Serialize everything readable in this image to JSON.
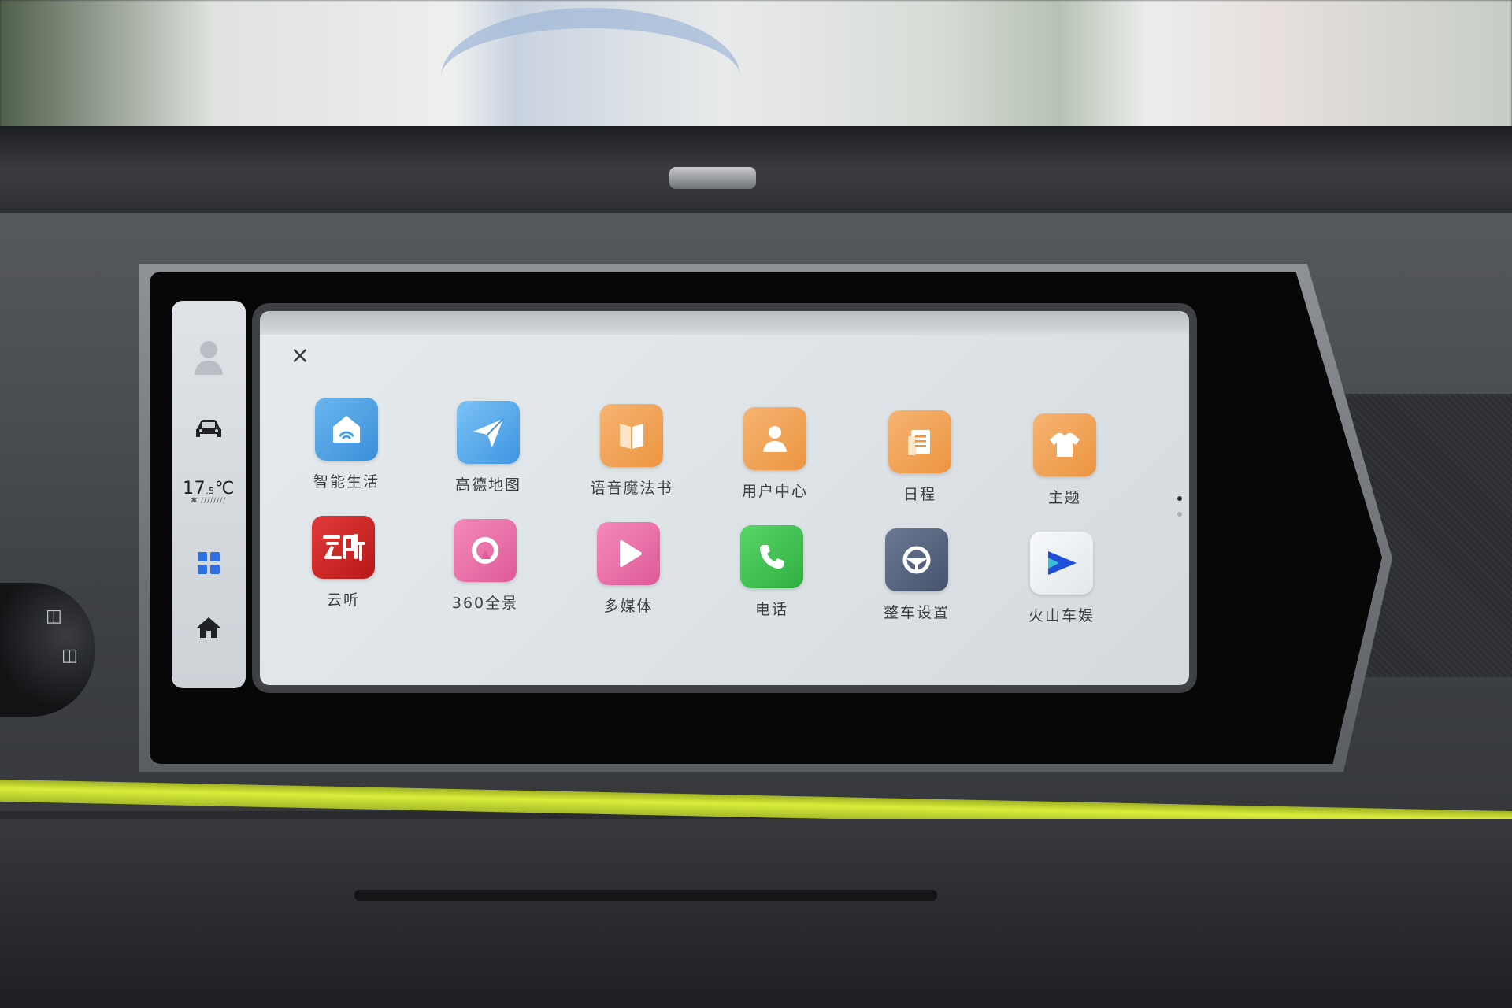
{
  "sidebar": {
    "temperature": "17.5℃",
    "temperature_main": "17",
    "temperature_sub": ".5",
    "temperature_unit": "℃"
  },
  "panel": {
    "close_label": "×",
    "apps_row1": [
      {
        "label": "智能生活",
        "icon": "smart-home-icon",
        "color": "#4a9fe0"
      },
      {
        "label": "高德地图",
        "icon": "paper-plane-map-icon",
        "color": "#4fa6e8"
      },
      {
        "label": "语音魔法书",
        "icon": "book-icon",
        "color": "#f0a156"
      },
      {
        "label": "用户中心",
        "icon": "user-icon",
        "color": "#f0a156"
      },
      {
        "label": "日程",
        "icon": "calendar-icon",
        "color": "#f0a156"
      },
      {
        "label": "主题",
        "icon": "shirt-icon",
        "color": "#f0a156"
      }
    ],
    "apps_row2": [
      {
        "label": "云听",
        "icon": "yunting-icon",
        "color": "#d22426"
      },
      {
        "label": "360全景",
        "icon": "360-view-icon",
        "color": "#e86fa6"
      },
      {
        "label": "多媒体",
        "icon": "play-icon",
        "color": "#e86fa6"
      },
      {
        "label": "电话",
        "icon": "phone-icon",
        "color": "#3fc24f"
      },
      {
        "label": "整车设置",
        "icon": "steering-wheel-icon",
        "color": "#5a6780"
      },
      {
        "label": "火山车娱",
        "icon": "volcano-play-icon",
        "color": "#f2f4f6"
      }
    ],
    "page_indicator": {
      "pages": 2,
      "current": 1
    }
  },
  "colors": {
    "accent_trim": "#cfe335",
    "apps_grid_icon": "#2f6fe0"
  }
}
